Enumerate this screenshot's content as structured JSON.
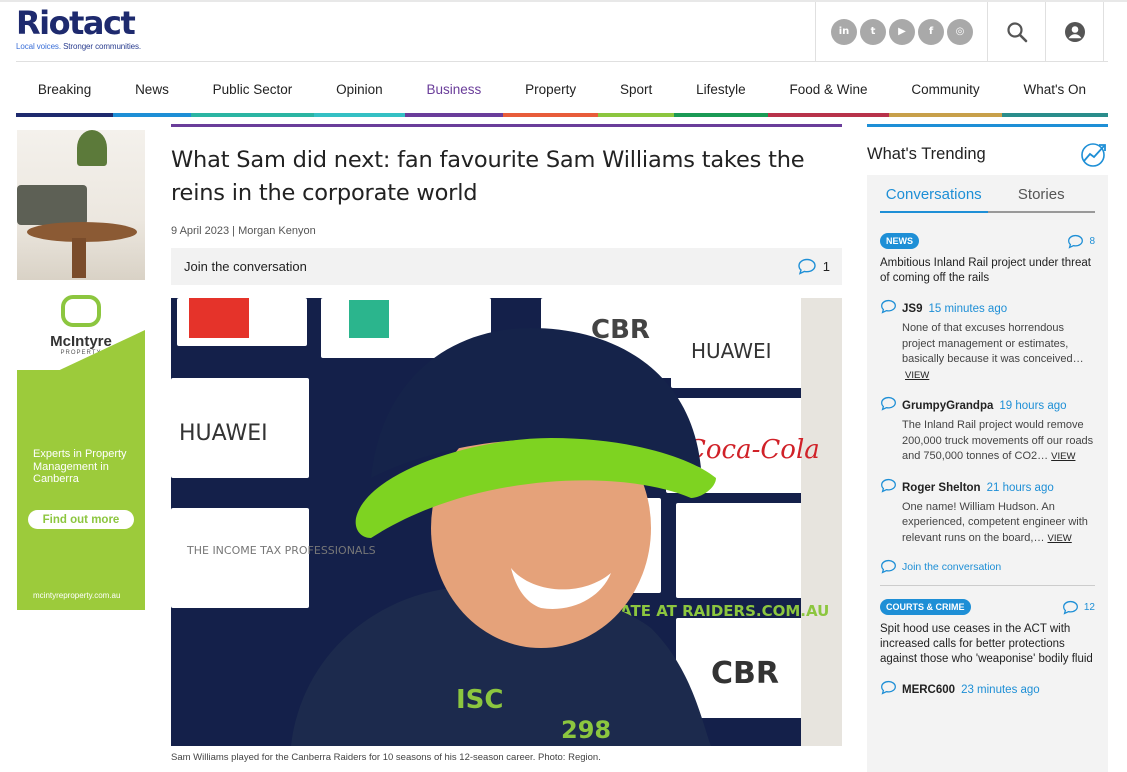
{
  "header": {
    "logo_text": "Riotact",
    "tagline_a": "Local voices.",
    "tagline_b": " Stronger communities.",
    "socials": [
      {
        "icon": "linkedin-icon",
        "glyph": "in"
      },
      {
        "icon": "twitter-icon",
        "glyph": "t"
      },
      {
        "icon": "youtube-icon",
        "glyph": "▶"
      },
      {
        "icon": "facebook-icon",
        "glyph": "f"
      },
      {
        "icon": "instagram-icon",
        "glyph": "◎"
      }
    ],
    "search_icon": "search-icon",
    "user_icon": "user-icon"
  },
  "nav": {
    "items": [
      {
        "label": "Breaking",
        "color": "#1e2a6e"
      },
      {
        "label": "News",
        "color": "#1e8fd6"
      },
      {
        "label": "Public Sector",
        "color": "#2bb5a3"
      },
      {
        "label": "Opinion",
        "color": "#35c0c4"
      },
      {
        "label": "Business",
        "color": "#6a3d9a"
      },
      {
        "label": "Property",
        "color": "#e85c3a"
      },
      {
        "label": "Sport",
        "color": "#8cc63f"
      },
      {
        "label": "Lifestyle",
        "color": "#1a9a55"
      },
      {
        "label": "Food & Wine",
        "color": "#b8324a"
      },
      {
        "label": "Community",
        "color": "#c8a04a"
      },
      {
        "label": "What's On",
        "color": "#2a8d8b"
      }
    ],
    "active": "Business"
  },
  "ad": {
    "brand_name": "McIntyre",
    "brand_sub": "PROPERTY",
    "text": "Experts in Property Management in Canberra",
    "button": "Find out more",
    "url": "mcintyreproperty.com.au"
  },
  "article": {
    "title": "What Sam did next: fan favourite Sam Williams takes the reins in the corporate world",
    "meta": "9 April 2023 | Morgan Kenyon",
    "conversation_label": "Join the conversation",
    "comment_count": "1",
    "caption": "Sam Williams played for the Canberra Raiders for 10 seasons of his 12-season career. Photo: Region.",
    "photo_signs": {
      "huawei": "HUAWEI",
      "itp": "THE INCOME TAX PROFESSIONALS",
      "coca": "Coca-Cola",
      "cbr": "CBR",
      "isc": "ISC",
      "raiders": "UP TO DATE AT RAIDERS.COM.AU",
      "number": "298"
    }
  },
  "sidebar": {
    "title": "What's Trending",
    "tabs": [
      "Conversations",
      "Stories"
    ],
    "active_tab": "Conversations",
    "items": [
      {
        "badge": "NEWS",
        "count": "8",
        "title": "Ambitious Inland Rail project under threat of coming off the rails",
        "comments": [
          {
            "name": "JS9",
            "time": "15 minutes ago",
            "text": "None of that excuses horrendous project management or estimates, basically because it was conceived…",
            "view": "VIEW"
          },
          {
            "name": "GrumpyGrandpa",
            "time": "19 hours ago",
            "text": "The Inland Rail project would remove 200,000 truck movements off our roads and 750,000 tonnes of CO2…",
            "view": "VIEW"
          },
          {
            "name": "Roger Shelton",
            "time": "21 hours ago",
            "text": "One name! William Hudson. An experienced, competent engineer with relevant runs on the board,…",
            "view": "VIEW"
          }
        ],
        "join": "Join the conversation"
      },
      {
        "badge": "COURTS & CRIME",
        "count": "12",
        "title": "Spit hood use ceases in the ACT with increased calls for better protections against those who 'weaponise' bodily fluid",
        "comments": [
          {
            "name": "MERC600",
            "time": "23 minutes ago"
          }
        ]
      }
    ]
  }
}
